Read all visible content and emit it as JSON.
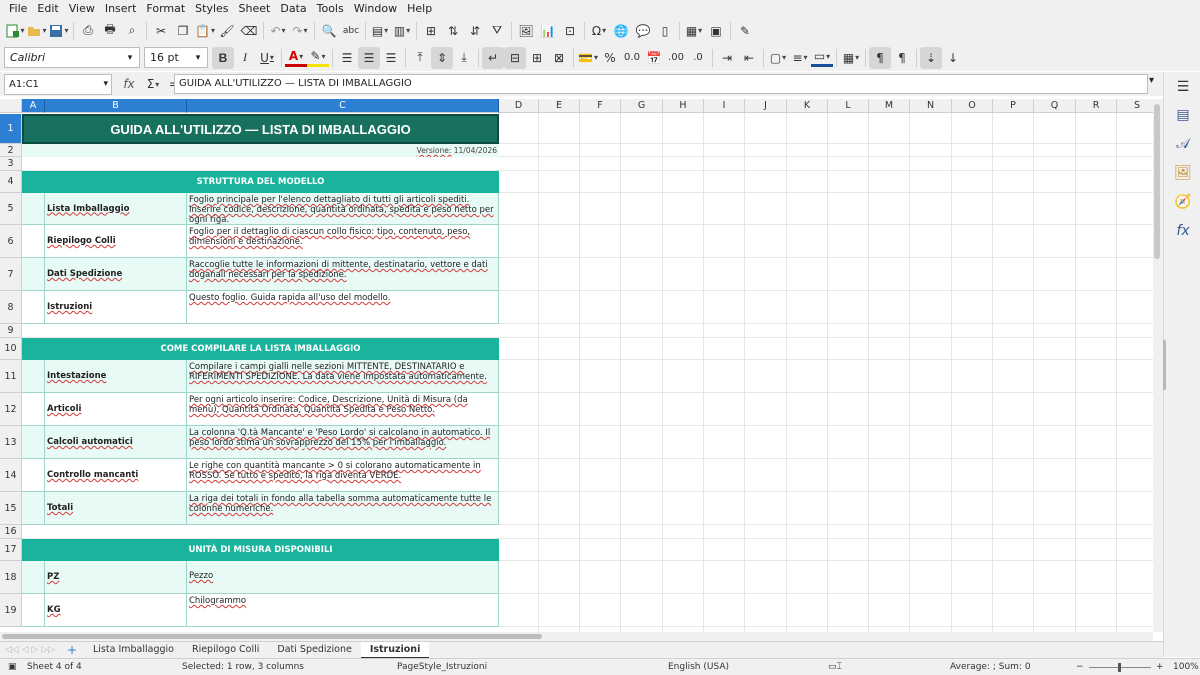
{
  "menu": [
    "File",
    "Edit",
    "View",
    "Insert",
    "Format",
    "Styles",
    "Sheet",
    "Data",
    "Tools",
    "Window",
    "Help"
  ],
  "font": {
    "name": "Calibri",
    "size": "16 pt"
  },
  "formula_bar": {
    "cell_ref": "A1:C1",
    "content": "GUIDA ALL'UTILIZZO — LISTA DI IMBALLAGGIO"
  },
  "columns": [
    "A",
    "B",
    "C",
    "D",
    "E",
    "F",
    "G",
    "H",
    "I",
    "J",
    "K",
    "L",
    "M",
    "N",
    "O",
    "P",
    "Q",
    "R",
    "S"
  ],
  "rows": [
    "1",
    "2",
    "3",
    "4",
    "5",
    "6",
    "7",
    "8",
    "9",
    "10",
    "11",
    "12",
    "13",
    "14",
    "15",
    "16",
    "17",
    "18",
    "19"
  ],
  "sheet": {
    "title": "GUIDA ALL'UTILIZZO — LISTA DI IMBALLAGGIO",
    "version_label": "Versione:",
    "version_date": "11/04/2026",
    "sections": [
      {
        "header": "STRUTTURA DEL MODELLO",
        "items": [
          {
            "label": "Lista Imballaggio",
            "desc": "Foglio principale per l'elenco dettagliato di tutti gli articoli spediti. Inserire codice, descrizione, quantità ordinata, spedita e peso netto per ogni riga."
          },
          {
            "label": "Riepilogo Colli",
            "desc": "Foglio per il dettaglio di ciascun collo fisico: tipo, contenuto, peso, dimensioni e destinazione."
          },
          {
            "label": "Dati Spedizione",
            "desc": "Raccoglie tutte le informazioni di mittente, destinatario, vettore e dati doganali necessari per la spedizione."
          },
          {
            "label": "Istruzioni",
            "desc": "Questo foglio. Guida rapida all'uso del modello."
          }
        ]
      },
      {
        "header": "COME COMPILARE LA LISTA IMBALLAGGIO",
        "items": [
          {
            "label": "Intestazione",
            "desc": "Compilare i campi gialli nelle sezioni MITTENTE, DESTINATARIO e RIFERIMENTI SPEDIZIONE. La data viene impostata automaticamente."
          },
          {
            "label": "Articoli",
            "desc": "Per ogni articolo inserire: Codice, Descrizione, Unità di Misura (da menù), Quantità Ordinata, Quantità Spedita e Peso Netto."
          },
          {
            "label": "Calcoli automatici",
            "desc": "La colonna 'Q.tà Mancante' e 'Peso Lordo' si calcolano in automatico. Il peso lordo stima un sovrapprezzo del 15% per l'imballaggio."
          },
          {
            "label": "Controllo mancanti",
            "desc": "Le righe con quantità mancante > 0 si colorano automaticamente in ROSSO. Se tutto è spedito, la riga diventa VERDE."
          },
          {
            "label": "Totali",
            "desc": "La riga dei totali in fondo alla tabella somma automaticamente tutte le colonne numeriche."
          }
        ]
      },
      {
        "header": "UNITÀ DI MISURA DISPONIBILI",
        "items": [
          {
            "label": "PZ",
            "desc": "Pezzo"
          },
          {
            "label": "KG",
            "desc": "Chilogrammo"
          }
        ]
      }
    ]
  },
  "tabs": [
    "Lista Imballaggio",
    "Riepilogo Colli",
    "Dati Spedizione",
    "Istruzioni"
  ],
  "active_tab": "Istruzioni",
  "status": {
    "sheet": "Sheet 4 of 4",
    "selection": "Selected: 1 row, 3 columns",
    "page_style": "PageStyle_Istruzioni",
    "language": "English (USA)",
    "summary": "Average: ; Sum: 0",
    "zoom": "100%"
  }
}
